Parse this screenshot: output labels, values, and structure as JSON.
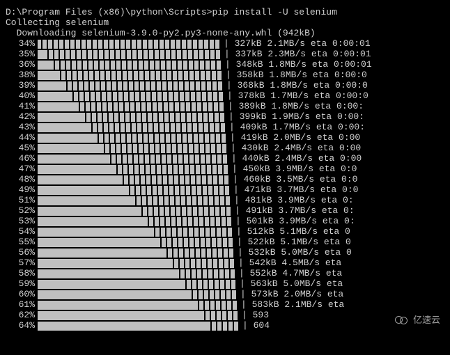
{
  "prompt": "D:\\Program Files (x86)\\python\\Scripts>pip install -U selenium",
  "status": "Collecting selenium",
  "downloading": "  Downloading selenium-3.9.0-py2.py3-none-any.whl (942kB)",
  "watermark": "亿速云",
  "rows": [
    {
      "pct": "34%",
      "barFill": 22,
      "stripes": 0,
      "stats": "| 327kB 2.1MB/s eta 0:00:01"
    },
    {
      "pct": "35%",
      "barFill": 24,
      "stripes": 0,
      "stats": "| 337kB 2.3MB/s eta 0:00:01"
    },
    {
      "pct": "36%",
      "barFill": 26,
      "stripes": 0,
      "stats": "| 348kB 1.8MB/s eta 0:00:01"
    },
    {
      "pct": "38%",
      "barFill": 28,
      "stripes": 0,
      "stats": "| 358kB 1.8MB/s eta 0:00:0"
    },
    {
      "pct": "39%",
      "barFill": 30,
      "stripes": 0,
      "stats": "| 368kB 1.8MB/s eta 0:00:0"
    },
    {
      "pct": "40%",
      "barFill": 32,
      "stripes": 0,
      "stats": "| 378kB 1.7MB/s eta 0:00:0"
    },
    {
      "pct": "41%",
      "barFill": 34,
      "stripes": 0,
      "stats": "| 389kB 1.8MB/s eta 0:00:"
    },
    {
      "pct": "42%",
      "barFill": 36,
      "stripes": 0,
      "stats": "| 399kB 1.9MB/s eta 0:00:"
    },
    {
      "pct": "43%",
      "barFill": 38,
      "stripes": 0,
      "stats": "| 409kB 1.7MB/s eta 0:00:"
    },
    {
      "pct": "44%",
      "barFill": 40,
      "stripes": 0,
      "stats": "| 419kB 2.0MB/s eta 0:00"
    },
    {
      "pct": "45%",
      "barFill": 42,
      "stripes": 0,
      "stats": "| 430kB 2.4MB/s eta 0:00"
    },
    {
      "pct": "46%",
      "barFill": 44,
      "stripes": 0,
      "stats": "| 440kB 2.4MB/s eta 0:00"
    },
    {
      "pct": "47%",
      "barFill": 46,
      "stripes": 0,
      "stats": "| 450kB 3.9MB/s eta 0:0"
    },
    {
      "pct": "48%",
      "barFill": 48,
      "stripes": 0,
      "stats": "| 460kB 3.5MB/s eta 0:0"
    },
    {
      "pct": "49%",
      "barFill": 50,
      "stripes": 0,
      "stats": "| 471kB 3.7MB/s eta 0:0"
    },
    {
      "pct": "51%",
      "barFill": 52,
      "stripes": 0,
      "stats": "| 481kB 3.9MB/s eta 0:"
    },
    {
      "pct": "52%",
      "barFill": 54,
      "stripes": 0,
      "stats": "| 491kB 3.7MB/s eta 0:"
    },
    {
      "pct": "53%",
      "barFill": 56,
      "stripes": 0,
      "stats": "| 501kB 3.9MB/s eta 0:"
    },
    {
      "pct": "54%",
      "barFill": 58,
      "stripes": 0,
      "stats": "| 512kB 5.1MB/s eta 0"
    },
    {
      "pct": "55%",
      "barFill": 60,
      "stripes": 0,
      "stats": "| 522kB 5.1MB/s eta 0"
    },
    {
      "pct": "56%",
      "barFill": 62,
      "stripes": 0,
      "stats": "| 532kB 5.0MB/s eta 0"
    },
    {
      "pct": "57%",
      "barFill": 64,
      "stripes": 0,
      "stats": "| 542kB 4.5MB/s eta "
    },
    {
      "pct": "58%",
      "barFill": 66,
      "stripes": 0,
      "stats": "| 552kB 4.7MB/s eta "
    },
    {
      "pct": "59%",
      "barFill": 68,
      "stripes": 0,
      "stats": "| 563kB 5.0MB/s eta"
    },
    {
      "pct": "60%",
      "barFill": 70,
      "stripes": 0,
      "stats": "| 573kB 2.0MB/s eta"
    },
    {
      "pct": "61%",
      "barFill": 72,
      "stripes": 0,
      "stats": "| 583kB 2.1MB/s eta"
    },
    {
      "pct": "62%",
      "barFill": 74,
      "stripes": 0,
      "stats": "| 593"
    },
    {
      "pct": "64%",
      "barFill": 76,
      "stripes": 0,
      "stats": "| 604"
    }
  ],
  "barBase": 5,
  "barScale": 9,
  "stripeMax": 32
}
